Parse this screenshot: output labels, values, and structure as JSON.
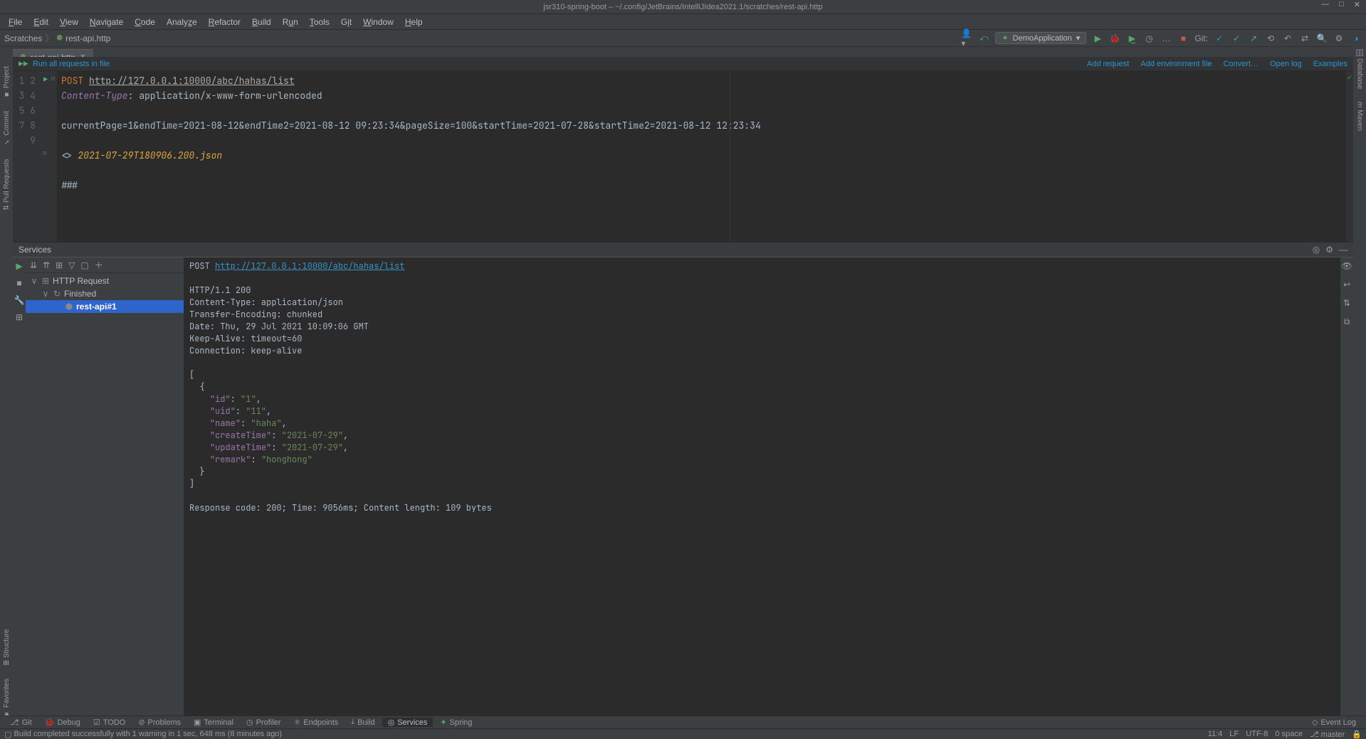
{
  "window": {
    "title": "jsr310-spring-boot – ~/.config/JetBrains/IntelliJIdea2021.1/scratches/rest-api.http"
  },
  "menu": [
    "File",
    "Edit",
    "View",
    "Navigate",
    "Code",
    "Analyze",
    "Refactor",
    "Build",
    "Run",
    "Tools",
    "Git",
    "Window",
    "Help"
  ],
  "breadcrumb": {
    "root": "Scratches",
    "file": "rest-api.http"
  },
  "runConfig": {
    "name": "DemoApplication",
    "gitLabel": "Git:"
  },
  "tab": {
    "name": "rest-api.http"
  },
  "leftTools": [
    "Project",
    "Commit",
    "Pull Requests",
    "Structure",
    "Favorites"
  ],
  "rightTools": [
    "Database",
    "Maven"
  ],
  "runbar": {
    "runAll": "Run all requests in file",
    "links": [
      "Add request",
      "Add environment file",
      "Convert…",
      "Open log",
      "Examples"
    ]
  },
  "editor": {
    "lineCount": 9,
    "method": "POST",
    "url": "http://127.0.0.1:10000/abc/hahas/list",
    "headerName": "Content-Type",
    "headerVal": ": application/x-www-form-urlencoded",
    "body": "currentPage=1&endTime=2021-08-12&endTime2=2021-08-12 09:23:34&pageSize=100&startTime=2021-07-28&startTime2=2021-08-12 12:23:34",
    "respLinkPrefix": "<> ",
    "respLinkFile": "2021-07-29T180906.200.json",
    "separator": "###"
  },
  "services": {
    "title": "Services",
    "tree": {
      "root": "HTTP Request",
      "child": "Finished",
      "leaf": "rest-api#1"
    },
    "response": {
      "methodLine": {
        "method": "POST",
        "url": "http://127.0.0.1:10000/abc/hahas/list"
      },
      "headers": [
        "HTTP/1.1 200",
        "Content-Type: application/json",
        "Transfer-Encoding: chunked",
        "Date: Thu, 29 Jul 2021 10:09:06 GMT",
        "Keep-Alive: timeout=60",
        "Connection: keep-alive"
      ],
      "json": {
        "id": "1",
        "uid": "11",
        "name": "haha",
        "createTime": "2021-07-29",
        "updateTime": "2021-07-29",
        "remark": "honghong"
      },
      "footer": "Response code: 200; Time: 9056ms; Content length: 109 bytes"
    }
  },
  "bottomTools": [
    "Git",
    "Debug",
    "TODO",
    "Problems",
    "Terminal",
    "Profiler",
    "Endpoints",
    "Build",
    "Services",
    "Spring"
  ],
  "eventLog": "Event Log",
  "status": {
    "msg": "Build completed successfully with 1 warning in 1 sec, 648 ms (8 minutes ago)",
    "pos": "11:4",
    "eol": "LF",
    "enc": "UTF-8",
    "indent": "0 space",
    "branch": "master"
  }
}
